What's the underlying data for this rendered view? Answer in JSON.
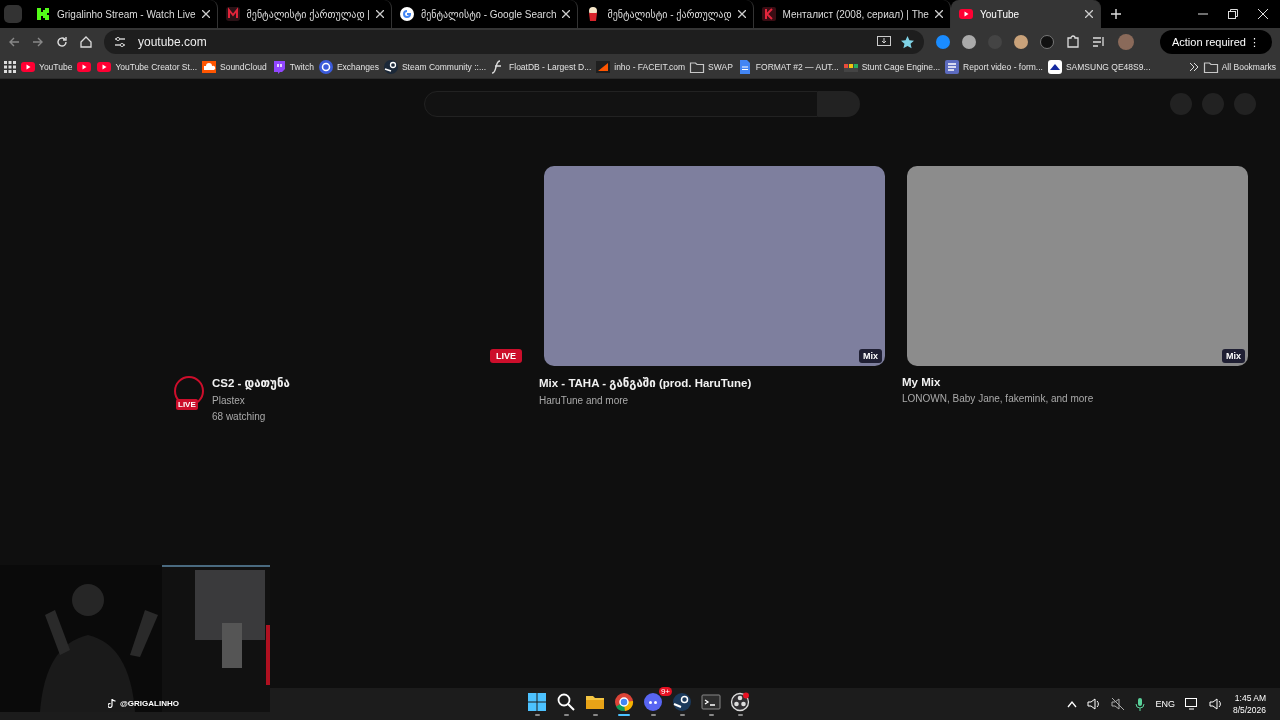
{
  "tabs": [
    {
      "title": "Grigalinho Stream - Watch Live",
      "kind": "kick",
      "selected": false
    },
    {
      "title": "მენტალისტი ქართულად | ",
      "kind": "m",
      "selected": false
    },
    {
      "title": "მენტალისტი - Google Search",
      "kind": "google",
      "selected": false
    },
    {
      "title": "მენტალისტი - ქართულად",
      "kind": "popcorn",
      "selected": false
    },
    {
      "title": "Менталист (2008, сериал) | The",
      "kind": "k",
      "selected": false
    },
    {
      "title": "YouTube",
      "kind": "youtube",
      "selected": true
    }
  ],
  "address_bar": {
    "value": "youtube.com"
  },
  "action_button": {
    "label": "Action required",
    "menu": "⋮"
  },
  "bookmarks": [
    {
      "label": "YouTube",
      "kind": "youtube"
    },
    {
      "kind": "youtube"
    },
    {
      "label": "YouTube Creator St...",
      "kind": "youtube"
    },
    {
      "label": "SoundCloud",
      "kind": "soundcloud"
    },
    {
      "label": "Twitch",
      "kind": "twitch"
    },
    {
      "label": "Exchanges",
      "kind": "exchanges"
    },
    {
      "label": "Steam Community ::...",
      "kind": "steam"
    },
    {
      "label": "FloatDB - Largest D...",
      "kind": "floatdb"
    },
    {
      "label": "inho - FACEIT.com",
      "kind": "faceit"
    },
    {
      "label": "SWAP",
      "kind": "folder"
    },
    {
      "label": "FORMAT #2 — AUT...",
      "kind": "doc"
    },
    {
      "label": "Stunt Cage Engine...",
      "kind": "stunt"
    },
    {
      "label": "Report video - form...",
      "kind": "report"
    },
    {
      "label": "SAMSUNG QE48S9...",
      "kind": "samsung"
    }
  ],
  "all_bookmarks": "All Bookmarks",
  "videos": [
    {
      "kind": "live",
      "badge": "LIVE",
      "avatar_badge": "LIVE",
      "title": "CS2 - დათუნა",
      "channel": "Plastex",
      "meta": "68 watching"
    },
    {
      "kind": "mix",
      "color": "#7e7f9e",
      "badge": "Mix",
      "title": "Mix - TAHA - განგაში (prod. HaruTune)",
      "channel": "HaruTune and more"
    },
    {
      "kind": "mix",
      "color": "#8c8c8c",
      "badge": "Mix",
      "title": "My Mix",
      "channel": "LONOWN, Baby Jane, fakemink, and more"
    }
  ],
  "webcam": {
    "kind": "picture",
    "handle": "@GRIGALINHO"
  },
  "taskbar": {
    "apps": [
      {
        "kind": "start",
        "active": false
      },
      {
        "kind": "search",
        "active": false
      },
      {
        "kind": "files",
        "active": false
      },
      {
        "kind": "chrome",
        "active": true
      },
      {
        "kind": "discord",
        "active": false,
        "badge": "9+"
      },
      {
        "kind": "steam",
        "active": false
      },
      {
        "kind": "terminal",
        "active": false
      },
      {
        "kind": "obs",
        "active": false
      }
    ],
    "language": "ENG",
    "time": "1:45 AM",
    "date": "8/5/2026"
  }
}
